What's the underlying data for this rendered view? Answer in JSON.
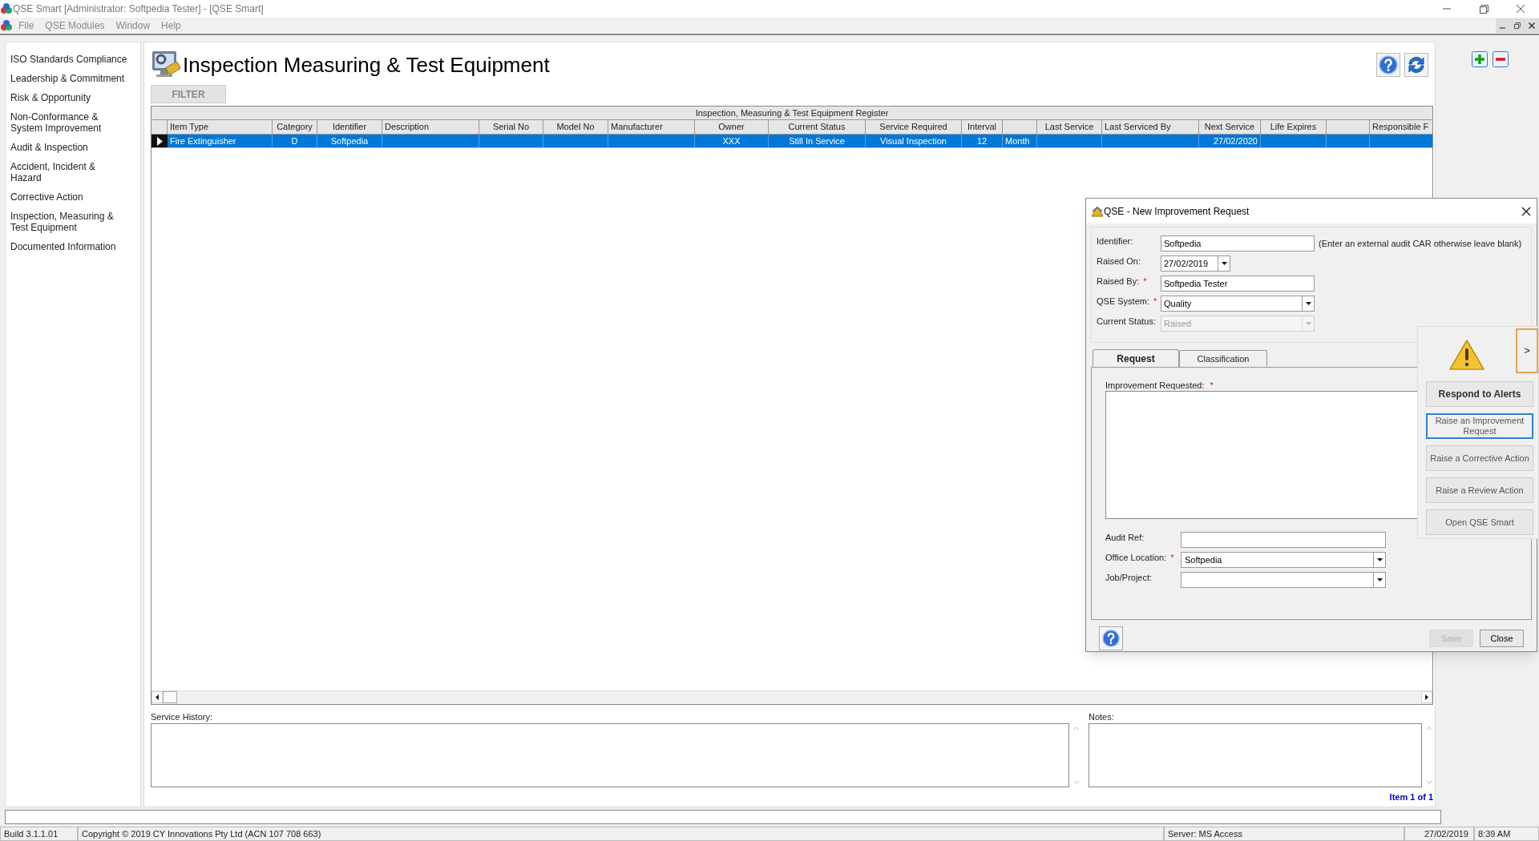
{
  "window": {
    "title": "QSE Smart  [Administrator: Softpedia Tester] - [QSE Smart]"
  },
  "menu": [
    "File",
    "QSE Modules",
    "Window",
    "Help"
  ],
  "sidebar": {
    "items": [
      "ISO Standards Compliance",
      "Leadership & Commitment",
      "Risk & Opportunity",
      "Non-Conformance & System Improvement",
      "Audit & Inspection",
      "Accident, Incident & Hazard",
      "Corrective Action",
      "Inspection, Measuring & Test Equipment",
      "Documented Information"
    ]
  },
  "page": {
    "title": "Inspection Measuring & Test Equipment",
    "filter_button": "FILTER"
  },
  "table": {
    "title": "Inspection, Measuring & Test Equipment Register",
    "columns": [
      {
        "label": "Item Type"
      },
      {
        "label": "Category"
      },
      {
        "label": "Identifier"
      },
      {
        "label": "Description"
      },
      {
        "label": "Serial No"
      },
      {
        "label": "Model No"
      },
      {
        "label": "Manufacturer"
      },
      {
        "label": "Owner"
      },
      {
        "label": "Current Status"
      },
      {
        "label": "Service Required"
      },
      {
        "label": "Interval"
      },
      {},
      {
        "label": "Last Service"
      },
      {
        "label": "Last Serviced By"
      },
      {
        "label": "Next Service"
      },
      {
        "label": "Life Expires"
      },
      {},
      {
        "label": "Responsible F"
      }
    ],
    "rows": [
      {
        "selected": true,
        "cells": [
          "Fire Extinguisher",
          "D",
          "Softpedia",
          null,
          null,
          null,
          null,
          "XXX",
          "Still In Service",
          "Visual Inspection",
          "12",
          "Month",
          null,
          null,
          "27/02/2020",
          null,
          null,
          null
        ]
      }
    ]
  },
  "service_history": {
    "label": "Service History:"
  },
  "notes": {
    "label": "Notes:"
  },
  "pager": "Item 1 of 1",
  "status_bar": {
    "build": "Build 3.1.1.01",
    "copyright": "Copyright © 2019 CY Innovations Pty Ltd (ACN 107 708 663)",
    "server": "Server: MS Access",
    "date": "27/02/2019",
    "time": "8:39 AM"
  },
  "dialog": {
    "title": "QSE - New Improvement Request",
    "fields": [
      {
        "kind": "text",
        "label": "Identifier:",
        "value": "Softpedia",
        "disabled": false,
        "hint": "(Enter an external audit CAR otherwise leave blank)"
      },
      {
        "kind": "date",
        "label": "Raised On:",
        "value": "27/02/2019",
        "disabled": false
      },
      {
        "kind": "text",
        "label": "Raised By:",
        "value": "Softpedia Tester",
        "required_mark": "*",
        "disabled": false
      },
      {
        "kind": "select",
        "label": "QSE System:",
        "value": "Quality",
        "required_mark": "*",
        "disabled": false
      },
      {
        "kind": "select",
        "label": "Current Status:",
        "value": "Raised",
        "disabled": true
      }
    ],
    "tabs": [
      {
        "label": "Request",
        "selected": true
      },
      {
        "label": "Classification",
        "selected": false
      }
    ],
    "improvement": {
      "label": "Improvement Requested:",
      "required_mark": "*"
    },
    "lower_fields": [
      {
        "kind": "text",
        "label": "Audit Ref:"
      },
      {
        "kind": "select",
        "label": "Office Location:",
        "value": "Softpedia",
        "required_mark": "*"
      },
      {
        "kind": "select",
        "label": "Job/Project:"
      }
    ],
    "buttons": [
      {
        "label": "Save",
        "disabled": true
      },
      {
        "label": "Close",
        "disabled": false
      }
    ]
  },
  "alerts_panel": {
    "expand": ">",
    "buttons": [
      {
        "kind": "heading",
        "label": "Respond to Alerts",
        "focused": false
      },
      {
        "kind": "action",
        "label": "Raise an Improvement Request",
        "focused": true
      },
      {
        "kind": "action",
        "label": "Raise a Corrective Action",
        "focused": false
      },
      {
        "kind": "action",
        "label": "Raise a Review Action",
        "focused": false
      },
      {
        "kind": "action",
        "label": "Open QSE Smart",
        "focused": false
      }
    ]
  }
}
